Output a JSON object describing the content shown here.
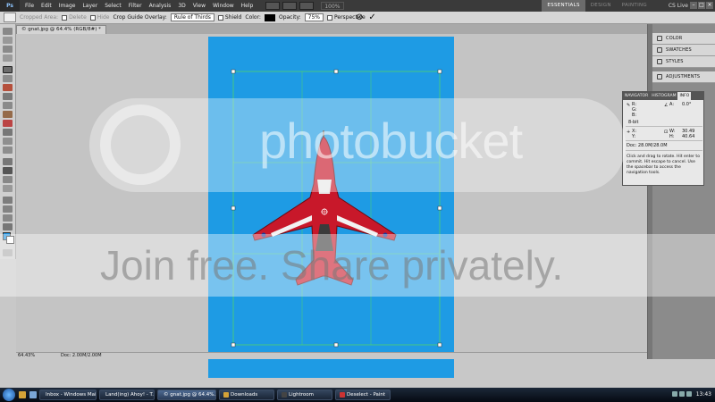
{
  "menubar": {
    "logo": "Ps",
    "items": [
      "File",
      "Edit",
      "Image",
      "Layer",
      "Select",
      "Filter",
      "Analysis",
      "3D",
      "View",
      "Window",
      "Help"
    ],
    "zoom": "100%",
    "workspaces": [
      "ESSENTIALS",
      "DESIGN",
      "PAINTING"
    ],
    "active_workspace": "ESSENTIALS",
    "cs_live": "CS Live"
  },
  "options": {
    "cropped_area": "Cropped Area:",
    "delete": "Delete",
    "hide": "Hide",
    "overlay_label": "Crop Guide Overlay:",
    "overlay_value": "Rule of Thirds",
    "shield": "Shield",
    "color": "Color:",
    "opacity_label": "Opacity:",
    "opacity_value": "75%",
    "perspective": "Perspective",
    "cancel_icon": "⊘",
    "commit_icon": "✓"
  },
  "document": {
    "tab": "© gnat.jpg @ 64.4% (RGB/8#) *",
    "zoom": "64.43%",
    "doc_size": "Doc: 2.00M/2.00M"
  },
  "watermark": {
    "logo": "photobucket",
    "band": "Join free. Share privately."
  },
  "dock": {
    "panels": [
      {
        "label": "COLOR",
        "icon": "color-icon"
      },
      {
        "label": "SWATCHES",
        "icon": "swatches-icon"
      },
      {
        "label": "STYLES",
        "icon": "styles-icon"
      },
      {
        "label": "ADJUSTMENTS",
        "icon": "adjustments-icon"
      }
    ]
  },
  "info_panel": {
    "tabs": [
      "NAVIGATOR",
      "HISTOGRAM",
      "INFO"
    ],
    "active_tab": "INFO",
    "r_label": "R:",
    "g_label": "G:",
    "b_label": "B:",
    "bit": "8-bit",
    "angle_label": "A:",
    "angle_value": "0.0°",
    "x_label": "X:",
    "y_label": "Y:",
    "w_label": "W:",
    "h_label": "H:",
    "w_value": "30.49",
    "h_value": "40.64",
    "doc": "Doc: 28.0M/28.0M",
    "help": "Click and drag to rotate. Hit enter to commit. Hit escape to cancel. Use the spacebar to access the navigation tools."
  },
  "taskbar": {
    "tasks": [
      {
        "label": "Inbox - Windows Mail",
        "color": "#7aa6d6"
      },
      {
        "label": "Land(ing) Ahoy! - T...",
        "color": "#e87a2a"
      },
      {
        "label": "© gnat.jpg @ 64.4%...",
        "color": "#1e5fa8"
      },
      {
        "label": "Downloads",
        "color": "#d4a237"
      },
      {
        "label": "Lightroom",
        "color": "#444"
      },
      {
        "label": "Deselect - Paint",
        "color": "#c33"
      }
    ],
    "active_task": 2,
    "clock": "13:43"
  },
  "colors": {
    "sky": "#1e9be4",
    "foreground": "#1b8fe0",
    "background_swatch": "#ffffff",
    "jet": "#c8182a"
  }
}
